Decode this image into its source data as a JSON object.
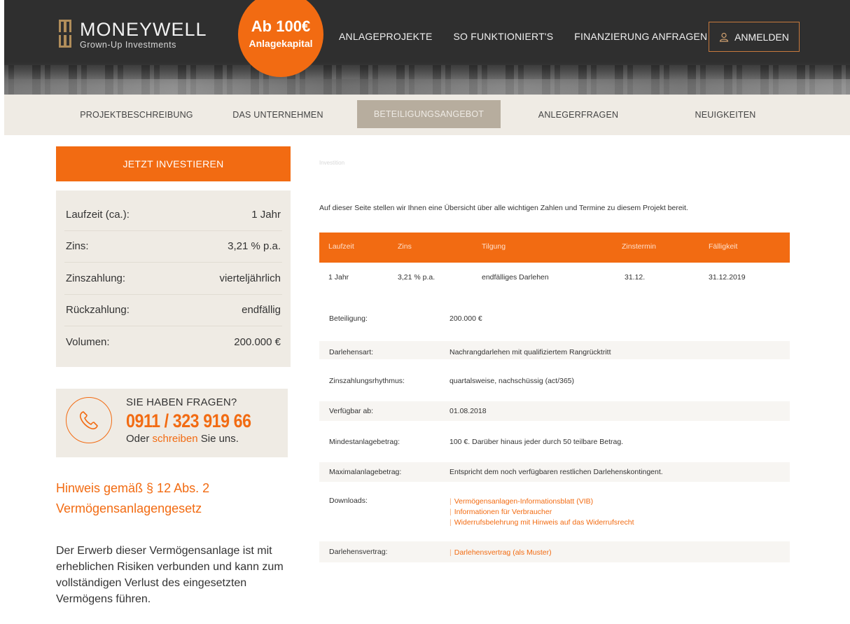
{
  "header": {
    "logo_name": "MONEYWELL",
    "logo_sub": "Grown-Up Investments",
    "badge_big": "Ab 100€",
    "badge_small": "Anlagekapital",
    "nav": [
      "ANLAGEPROJEKTE",
      "SO FUNKTIONIERT'S",
      "FINANZIERUNG ANFRAGEN"
    ],
    "login_label": "ANMELDEN",
    "login_icon": "user-icon"
  },
  "tabs": [
    "PROJEKTBESCHREIBUNG",
    "DAS UNTERNEHMEN",
    "BETEILIGUNGSANGEBOT",
    "ANLEGERFRAGEN",
    "NEUIGKEITEN"
  ],
  "active_tab": "BETEILIGUNGSANGEBOT",
  "sidebar": {
    "cta_label": "JETZT INVESTIEREN",
    "facts": [
      {
        "label": "Laufzeit (ca.):",
        "value": "1 Jahr"
      },
      {
        "label": "Zins:",
        "value": "3,21 % p.a."
      },
      {
        "label": "Zinszahlung:",
        "value": "vierteljährlich"
      },
      {
        "label": "Rückzahlung:",
        "value": "endfällig"
      },
      {
        "label": "Volumen:",
        "value": "200.000 €"
      }
    ],
    "contact": {
      "question": "SIE HABEN FRAGEN?",
      "phone": "0911 / 323 919 66",
      "write_pre": "Oder ",
      "write_link": "schreiben",
      "write_post": " Sie uns.",
      "icon": "phone-icon"
    },
    "notice_title": "Hinweis gemäß § 12 Abs. 2 Vermögensanlagengesetz",
    "notice_body": "Der Erwerb dieser Vermögensanlage ist mit erheblichen Risiken verbunden und kann zum vollständigen Verlust des eingesetzten Vermögens führen."
  },
  "main": {
    "breadcrumb": "Investition",
    "intro": "Auf dieser Seite stellen wir Ihnen eine Übersicht über alle wichtigen Zahlen und Termine zu diesem Projekt bereit.",
    "table": {
      "headers": [
        "Laufzeit",
        "Zins",
        "Tilgung",
        "Zinstermin",
        "Fälligkeit"
      ],
      "row": [
        "1 Jahr",
        "3,21 % p.a.",
        "endfälliges Darlehen",
        "31.12.",
        "31.12.2019"
      ]
    },
    "details": [
      {
        "label": "Beteiligung:",
        "value": "200.000 €"
      },
      {
        "label": "Darlehensart:",
        "value": "Nachrangdarlehen mit qualifiziertem Rangrücktritt"
      },
      {
        "label": "Zinszahlungsrhythmus:",
        "value": "quartalsweise, nachschüssig (act/365)"
      },
      {
        "label": "Verfügbar ab:",
        "value": "01.08.2018"
      },
      {
        "label": "Mindestanlagebetrag:",
        "value": "100 €. Darüber hinaus jeder durch 50 teilbare Betrag."
      },
      {
        "label": "Maximalanlagebetrag:",
        "value": "Entspricht dem noch verfügbaren restlichen Darlehenskontingent."
      }
    ],
    "downloads_label": "Downloads:",
    "downloads": [
      "Vermögensanlagen-Informationsblatt (VIB)",
      "Informationen für Verbraucher",
      "Widerrufsbelehrung mit Hinweis auf das Widerrufsrecht"
    ],
    "contract_label": "Darlehensvertrag:",
    "contract_link": "Darlehensvertrag (als Muster)"
  },
  "colors": {
    "accent": "#f26b12",
    "tab_active": "#b7ad9e",
    "panel": "#efebe4",
    "header": "#2f2f2f"
  }
}
